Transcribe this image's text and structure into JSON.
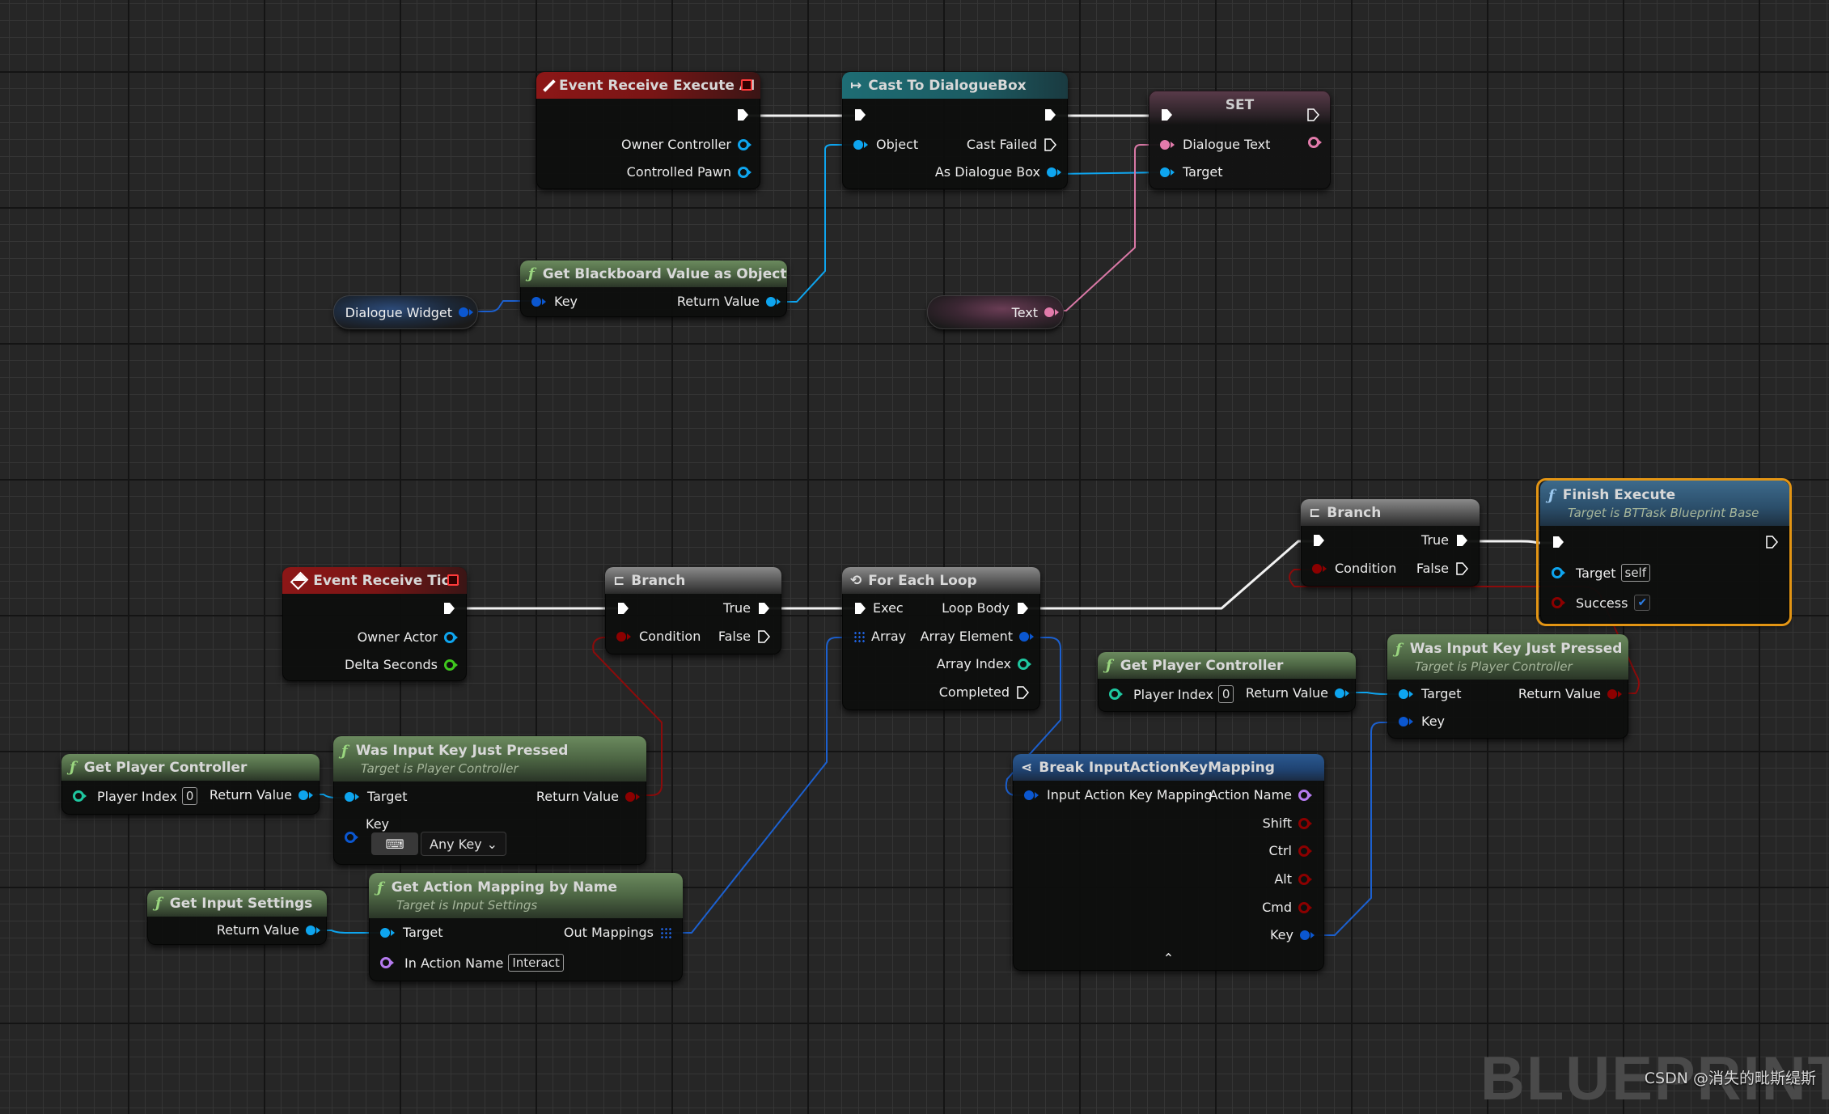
{
  "colors": {
    "exec": "#ffffff",
    "object": "#00a8f4",
    "struct": "#0b57d0",
    "text": "#e27bab",
    "bool": "#8c0000",
    "int": "#1fc7a0",
    "float": "#3fc81e",
    "name": "#b57bef",
    "selected_outline": "#e39514"
  },
  "nodes": {
    "event_execute_ai": {
      "title": "Event Receive Execute AI",
      "pins_out": [
        "Owner Controller",
        "Controlled Pawn"
      ]
    },
    "cast_dialoguebox": {
      "title": "Cast To DialogueBox",
      "pins_in": [
        "Object"
      ],
      "pins_out": [
        "Cast Failed",
        "As Dialogue Box"
      ]
    },
    "set_node": {
      "title": "SET",
      "pins_in": [
        "Dialogue Text",
        "Target"
      ]
    },
    "get_blackboard": {
      "title": "Get Blackboard Value as Object",
      "pins_in": [
        "Key"
      ],
      "pins_out": [
        "Return Value"
      ]
    },
    "var_dialogue_widget": {
      "label": "Dialogue Widget"
    },
    "var_text": {
      "label": "Text"
    },
    "event_tick": {
      "title": "Event Receive Tick",
      "pins_out": [
        "Owner Actor",
        "Delta Seconds"
      ]
    },
    "branch_1": {
      "title": "Branch",
      "pins_in": [
        "Condition"
      ],
      "pins_out": [
        "True",
        "False"
      ]
    },
    "for_each": {
      "title": "For Each Loop",
      "pins_in": [
        "Exec",
        "Array"
      ],
      "pins_out": [
        "Loop Body",
        "Array Element",
        "Array Index",
        "Completed"
      ]
    },
    "branch_2": {
      "title": "Branch",
      "pins_in": [
        "Condition"
      ],
      "pins_out": [
        "True",
        "False"
      ]
    },
    "finish_execute": {
      "title": "Finish Execute",
      "subtitle": "Target is BTTask Blueprint Base",
      "pins_in": [
        "Target",
        "Success"
      ],
      "target_value": "self",
      "success_checked": true,
      "check_glyph": "✔"
    },
    "get_player_controller_2": {
      "title": "Get Player Controller",
      "pins_in": [
        "Player Index"
      ],
      "player_index": "0",
      "pins_out": [
        "Return Value"
      ]
    },
    "was_input_key_2": {
      "title": "Was Input Key Just Pressed",
      "subtitle": "Target is Player Controller",
      "pins_in": [
        "Target",
        "Key"
      ],
      "pins_out": [
        "Return Value"
      ]
    },
    "break_mapping": {
      "title": "Break InputActionKeyMapping",
      "pins_in": [
        "Input Action Key Mapping"
      ],
      "pins_out": [
        "Action Name",
        "Shift",
        "Ctrl",
        "Alt",
        "Cmd",
        "Key"
      ],
      "collapse_glyph": "⌃"
    },
    "get_player_controller_1": {
      "title": "Get Player Controller",
      "pins_in": [
        "Player Index"
      ],
      "player_index": "0",
      "pins_out": [
        "Return Value"
      ]
    },
    "was_input_key_1": {
      "title": "Was Input Key Just Pressed",
      "subtitle": "Target is Player Controller",
      "pins_in": [
        "Target",
        "Key"
      ],
      "key_value": "Any Key",
      "keyboard_glyph": "⌨",
      "dropdown_glyph": "⌄",
      "pins_out": [
        "Return Value"
      ]
    },
    "get_input_settings": {
      "title": "Get Input Settings",
      "pins_out": [
        "Return Value"
      ]
    },
    "get_action_mapping": {
      "title": "Get Action Mapping by Name",
      "subtitle": "Target is Input Settings",
      "pins_in": [
        "Target",
        "In Action Name"
      ],
      "action_name": "Interact",
      "pins_out": [
        "Out Mappings"
      ]
    }
  },
  "icons": {
    "function": "ƒ",
    "branch": "⊏",
    "loop": "⟲",
    "cast": "↦",
    "break": "⋖"
  },
  "watermark": "BLUEPRINT",
  "credit": "CSDN @消失的毗斯缇斯"
}
